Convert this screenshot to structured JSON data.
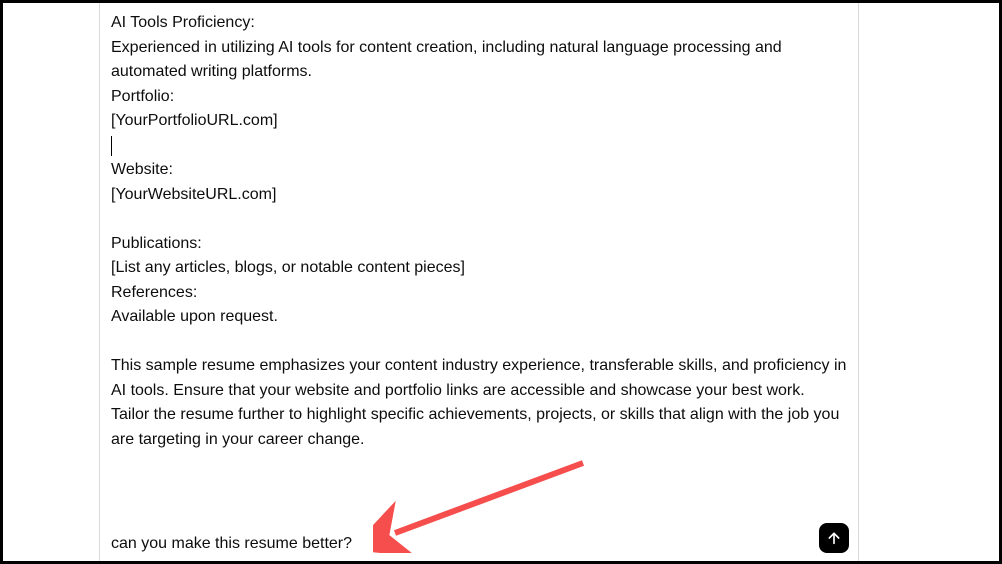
{
  "content": {
    "ai_tools_heading": "AI Tools Proficiency:",
    "ai_tools_body": "Experienced in utilizing AI tools for content creation, including natural language processing and automated writing platforms.",
    "portfolio_heading": "Portfolio:",
    "portfolio_value": "[YourPortfolioURL.com]",
    "website_heading": "Website:",
    "website_value": "[YourWebsiteURL.com]",
    "publications_heading": "Publications:",
    "publications_value": "[List any articles, blogs, or notable content pieces]",
    "references_heading": "References:",
    "references_value": "Available upon request.",
    "closing": "This sample resume emphasizes your content industry experience, transferable skills, and proficiency in AI tools. Ensure that your website and portfolio links are accessible and showcase your best work. Tailor the resume further to highlight specific achievements, projects, or skills that align with the job you are targeting in your career change."
  },
  "followup_prompt": "can you make this resume better?",
  "annotation": {
    "arrow_color": "#f64d4d"
  }
}
